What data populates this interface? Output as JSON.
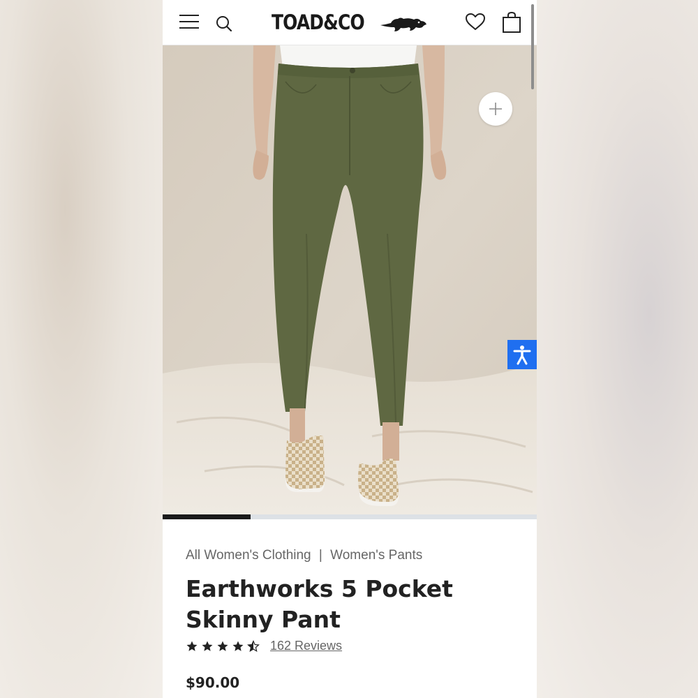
{
  "header": {
    "brand": "TOAD&CO",
    "icons": {
      "menu": "menu-icon",
      "search": "search-icon",
      "wishlist": "heart-icon",
      "bag": "shopping-bag-icon"
    }
  },
  "product": {
    "breadcrumb": [
      "All Women's Clothing",
      "Women's Pants"
    ],
    "breadcrumb_separator": "|",
    "title": "Earthworks 5 Pocket Skinny Pant",
    "rating": 4.5,
    "reviews": "162 Reviews",
    "price": "$90.00",
    "color": "olive green",
    "image_carousel_progress": 0.235
  },
  "controls": {
    "zoom_icon": "plus-icon",
    "accessibility_icon": "accessibility-icon"
  },
  "colors": {
    "accent": "#1f6ff0",
    "text": "#222222",
    "muted": "#666666",
    "pant": "#5f6842",
    "backdrop": "#d9d0c2"
  }
}
